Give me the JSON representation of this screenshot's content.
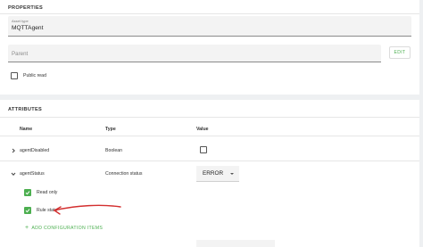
{
  "properties": {
    "title": "PROPERTIES",
    "asset_type_label": "Asset type",
    "asset_type_value": "MQTTAgent",
    "parent_placeholder": "Parent",
    "edit_label": "EDIT",
    "public_read_label": "Public read",
    "public_read_checked": false
  },
  "attributes": {
    "title": "ATTRIBUTES",
    "columns": {
      "name": "Name",
      "type": "Type",
      "value": "Value"
    },
    "rows": [
      {
        "name": "agentDisabled",
        "type": "Boolean",
        "expanded": false,
        "value_checked": false
      },
      {
        "name": "agentStatus",
        "type": "Connection status",
        "expanded": true,
        "value": "ERROR"
      }
    ],
    "config_items": [
      {
        "label": "Read only",
        "checked": true
      },
      {
        "label": "Rule state",
        "checked": true
      }
    ],
    "add_config_label": "ADD CONFIGURATION ITEMS"
  },
  "colors": {
    "accent": "#4caf50",
    "annotation": "#d32f2f"
  }
}
